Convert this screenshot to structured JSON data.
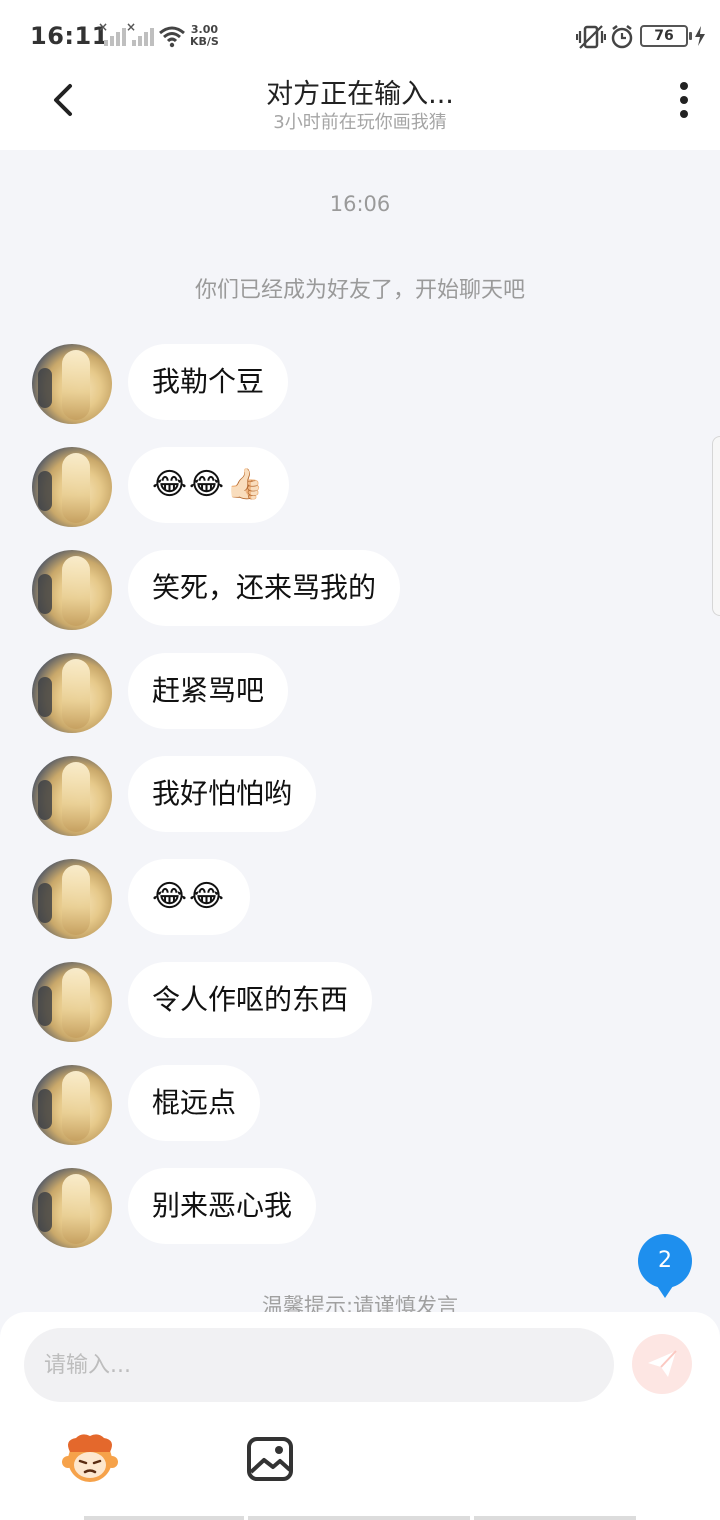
{
  "status_bar": {
    "time": "16:11",
    "net_speed_value": "3.00",
    "net_speed_unit": "KB/S",
    "battery": "76"
  },
  "header": {
    "title": "对方正在输入...",
    "subtitle": "3小时前在玩你画我猜"
  },
  "chat": {
    "timestamp": "16:06",
    "system_message": "你们已经成为好友了，开始聊天吧",
    "messages": [
      {
        "text": "我勒个豆"
      },
      {
        "text": "😂😂👍🏻"
      },
      {
        "text": "笑死，还来骂我的"
      },
      {
        "text": "赶紧骂吧"
      },
      {
        "text": "我好怕怕哟"
      },
      {
        "text": "😂😂"
      },
      {
        "text": "令人作呕的东西"
      },
      {
        "text": "棍远点"
      },
      {
        "text": "别来恶心我"
      }
    ],
    "warning_tip": "温馨提示:请谨慎发言",
    "unread_count": "2"
  },
  "composer": {
    "placeholder": "请输入..."
  },
  "icons": {
    "back": "chevron-left-icon",
    "more": "more-vertical-icon",
    "send": "paper-plane-icon",
    "mascot": "mascot-emoji-icon",
    "image": "image-icon"
  },
  "colors": {
    "background": "#f4f5f9",
    "bubble": "#ffffff",
    "badge": "#1e8fee",
    "send_button": "#fde6e3"
  }
}
